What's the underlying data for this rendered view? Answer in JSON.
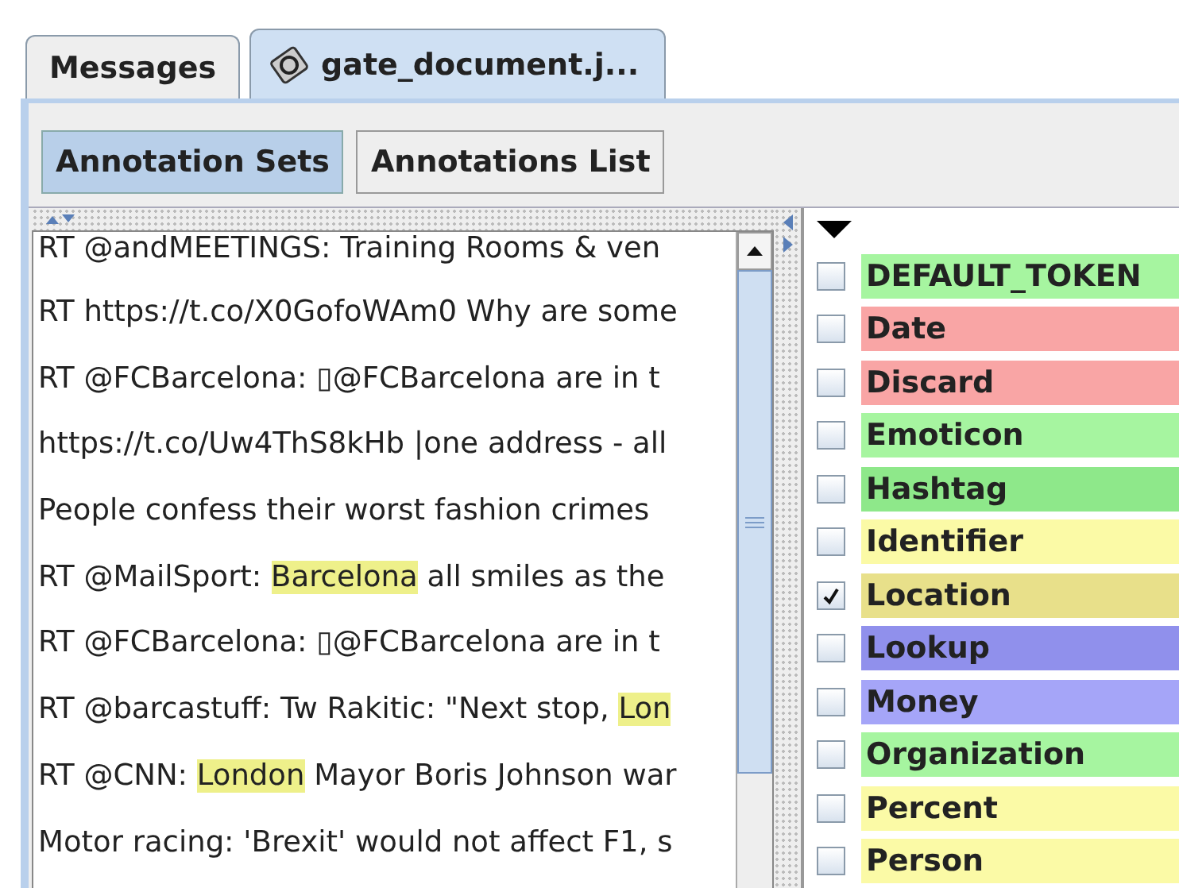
{
  "tabs": [
    {
      "label": "Messages",
      "selected": false,
      "icon": false
    },
    {
      "label": "gate_document.j...",
      "selected": true,
      "icon": true
    }
  ],
  "toolbar": [
    {
      "label": "Annotation Sets",
      "selected": true
    },
    {
      "label": "Annotations List",
      "selected": false
    }
  ],
  "document_lines": [
    [
      {
        "text": "RT @andMEETINGS: Training Rooms & ven",
        "highlighted": false
      }
    ],
    [
      {
        "text": "RT https://t.co/X0GofoWAm0 Why are some",
        "highlighted": false
      }
    ],
    [
      {
        "text": "RT @FCBarcelona: ▯@FCBarcelona are in t",
        "highlighted": false
      }
    ],
    [
      {
        "text": "https://t.co/Uw4ThS8kHb |one address - all",
        "highlighted": false
      }
    ],
    [
      {
        "text": "People confess their worst fashion crimes",
        "highlighted": false
      }
    ],
    [
      {
        "text": "RT @MailSport: ",
        "highlighted": false
      },
      {
        "text": "Barcelona",
        "highlighted": true
      },
      {
        "text": " all smiles as the",
        "highlighted": false
      }
    ],
    [
      {
        "text": "RT @FCBarcelona: ▯@FCBarcelona are in t",
        "highlighted": false
      }
    ],
    [
      {
        "text": "RT @barcastuff: Tw Rakitic: \"Next stop, ",
        "highlighted": false
      },
      {
        "text": "Lon",
        "highlighted": true
      }
    ],
    [
      {
        "text": "RT @CNN: ",
        "highlighted": false
      },
      {
        "text": "London",
        "highlighted": true
      },
      {
        "text": " Mayor Boris Johnson war",
        "highlighted": false
      }
    ],
    [
      {
        "text": "Motor racing: 'Brexit' would not affect F1, s",
        "highlighted": false
      }
    ]
  ],
  "annotation_types": [
    {
      "name": "DEFAULT_TOKEN",
      "checked": false,
      "color": "#a6f5a0"
    },
    {
      "name": "Date",
      "checked": false,
      "color": "#f9a5a5"
    },
    {
      "name": "Discard",
      "checked": false,
      "color": "#f9a5a5"
    },
    {
      "name": "Emoticon",
      "checked": false,
      "color": "#a6f5a0"
    },
    {
      "name": "Hashtag",
      "checked": false,
      "color": "#8ee88a"
    },
    {
      "name": "Identifier",
      "checked": false,
      "color": "#fbfaa6"
    },
    {
      "name": "Location",
      "checked": true,
      "color": "#e8e08a"
    },
    {
      "name": "Lookup",
      "checked": false,
      "color": "#9090ec"
    },
    {
      "name": "Money",
      "checked": false,
      "color": "#a5a5f8"
    },
    {
      "name": "Organization",
      "checked": false,
      "color": "#a6f5a0"
    },
    {
      "name": "Percent",
      "checked": false,
      "color": "#fbfaa6"
    },
    {
      "name": "Person",
      "checked": false,
      "color": "#fbfaa6"
    }
  ]
}
